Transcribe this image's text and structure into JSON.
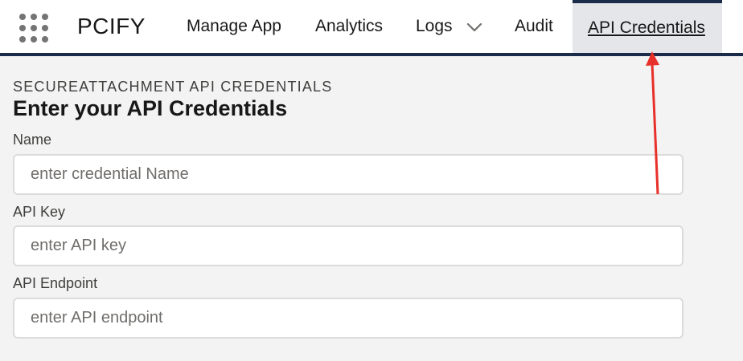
{
  "app": {
    "name": "PCIFY"
  },
  "nav": {
    "items": [
      {
        "label": "Manage App"
      },
      {
        "label": "Analytics"
      },
      {
        "label": "Logs"
      },
      {
        "label": "Audit"
      },
      {
        "label": "API Credentials",
        "active": true
      }
    ]
  },
  "page": {
    "eyebrow": "SECUREATTACHMENT API CREDENTIALS",
    "title": "Enter your API Credentials"
  },
  "form": {
    "name": {
      "label": "Name",
      "value": "",
      "placeholder": "enter credential Name"
    },
    "api_key": {
      "label": "API Key",
      "value": "",
      "placeholder": "enter API key"
    },
    "api_endpoint": {
      "label": "API Endpoint",
      "value": "",
      "placeholder": "enter API endpoint"
    }
  },
  "colors": {
    "nav_border": "#1b2b4a",
    "active_tab_bg": "#e5e6ea",
    "page_bg": "#f3f3f3",
    "annotation_arrow": "#e8302a"
  },
  "icons": {
    "app_launcher": "waffle-grid-icon",
    "logs_menu": "chevron-down-icon"
  }
}
